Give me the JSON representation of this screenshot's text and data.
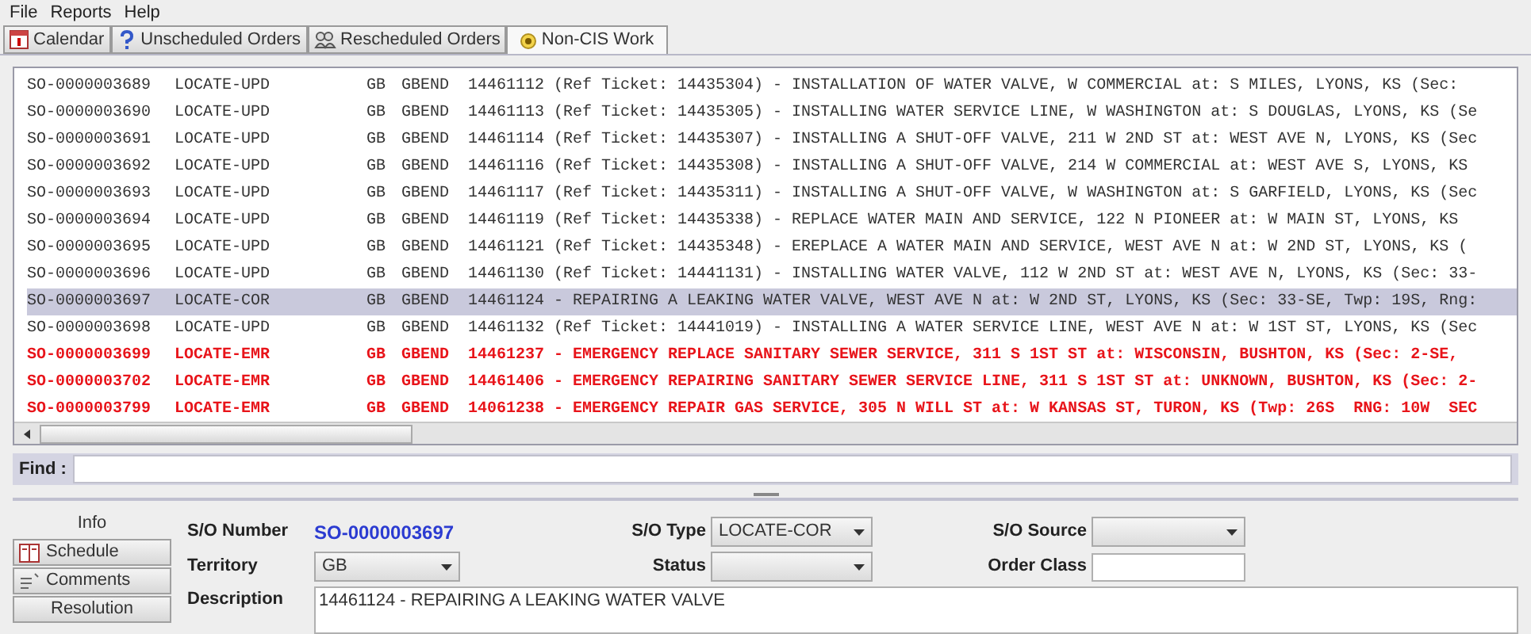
{
  "menu": [
    "File",
    "Reports",
    "Help"
  ],
  "tabs": [
    {
      "label": "Calendar",
      "selected": false
    },
    {
      "label": "Unscheduled Orders",
      "selected": false
    },
    {
      "label": "Rescheduled Orders",
      "selected": false
    },
    {
      "label": "Non-CIS Work",
      "selected": true
    }
  ],
  "rows": [
    {
      "number": "SO-0000003689",
      "type": "LOCATE-UPD",
      "territory": "GB",
      "area": "GBEND",
      "description": "14461112 (Ref Ticket: 14435304) - INSTALLATION OF WATER VALVE, W COMMERCIAL at: S MILES, LYONS, KS (Sec:",
      "emergency": false,
      "selected": false
    },
    {
      "number": "SO-0000003690",
      "type": "LOCATE-UPD",
      "territory": "GB",
      "area": "GBEND",
      "description": "14461113 (Ref Ticket: 14435305) - INSTALLING WATER SERVICE LINE, W WASHINGTON at: S DOUGLAS, LYONS, KS (Se",
      "emergency": false,
      "selected": false
    },
    {
      "number": "SO-0000003691",
      "type": "LOCATE-UPD",
      "territory": "GB",
      "area": "GBEND",
      "description": "14461114 (Ref Ticket: 14435307) - INSTALLING A SHUT-OFF VALVE, 211 W 2ND ST at: WEST AVE N, LYONS, KS (Sec",
      "emergency": false,
      "selected": false
    },
    {
      "number": "SO-0000003692",
      "type": "LOCATE-UPD",
      "territory": "GB",
      "area": "GBEND",
      "description": "14461116 (Ref Ticket: 14435308) - INSTALLING A SHUT-OFF VALVE, 214 W COMMERCIAL at: WEST AVE S, LYONS, KS",
      "emergency": false,
      "selected": false
    },
    {
      "number": "SO-0000003693",
      "type": "LOCATE-UPD",
      "territory": "GB",
      "area": "GBEND",
      "description": "14461117 (Ref Ticket: 14435311) - INSTALLING A SHUT-OFF VALVE, W WASHINGTON at: S GARFIELD, LYONS, KS (Sec",
      "emergency": false,
      "selected": false
    },
    {
      "number": "SO-0000003694",
      "type": "LOCATE-UPD",
      "territory": "GB",
      "area": "GBEND",
      "description": "14461119 (Ref Ticket: 14435338) - REPLACE WATER MAIN AND SERVICE, 122 N PIONEER at: W MAIN ST, LYONS, KS",
      "emergency": false,
      "selected": false
    },
    {
      "number": "SO-0000003695",
      "type": "LOCATE-UPD",
      "territory": "GB",
      "area": "GBEND",
      "description": "14461121 (Ref Ticket: 14435348) - EREPLACE A WATER MAIN AND SERVICE, WEST AVE N at: W 2ND ST, LYONS, KS (",
      "emergency": false,
      "selected": false
    },
    {
      "number": "SO-0000003696",
      "type": "LOCATE-UPD",
      "territory": "GB",
      "area": "GBEND",
      "description": "14461130 (Ref Ticket: 14441131) - INSTALLING WATER VALVE, 112 W 2ND ST at: WEST AVE N, LYONS, KS (Sec: 33-",
      "emergency": false,
      "selected": false
    },
    {
      "number": "SO-0000003697",
      "type": "LOCATE-COR",
      "territory": "GB",
      "area": "GBEND",
      "description": "14461124 - REPAIRING A LEAKING WATER VALVE, WEST AVE N at: W 2ND ST, LYONS, KS (Sec: 33-SE, Twp: 19S, Rng:",
      "emergency": false,
      "selected": true
    },
    {
      "number": "SO-0000003698",
      "type": "LOCATE-UPD",
      "territory": "GB",
      "area": "GBEND",
      "description": "14461132 (Ref Ticket: 14441019) - INSTALLING A WATER SERVICE LINE, WEST AVE N at: W 1ST ST, LYONS, KS (Sec",
      "emergency": false,
      "selected": false
    },
    {
      "number": "SO-0000003699",
      "type": "LOCATE-EMR",
      "territory": "GB",
      "area": "GBEND",
      "description": "14461237 - EMERGENCY REPLACE SANITARY SEWER SERVICE, 311 S 1ST ST at: WISCONSIN, BUSHTON, KS (Sec: 2-SE,",
      "emergency": true,
      "selected": false
    },
    {
      "number": "SO-0000003702",
      "type": "LOCATE-EMR",
      "territory": "GB",
      "area": "GBEND",
      "description": "14461406 - EMERGENCY REPAIRING SANITARY SEWER SERVICE LINE, 311 S 1ST ST at: UNKNOWN, BUSHTON, KS (Sec: 2-",
      "emergency": true,
      "selected": false
    },
    {
      "number": "SO-0000003799",
      "type": "LOCATE-EMR",
      "territory": "GB",
      "area": "GBEND",
      "description": "14061238 - EMERGENCY REPAIR GAS SERVICE, 305 N WILL ST at: W KANSAS ST, TURON, KS (Twp: 26S  RNG: 10W  SEC",
      "emergency": true,
      "selected": false
    }
  ],
  "find": {
    "label": "Find :"
  },
  "nav": [
    {
      "label": "Info",
      "selected": true
    },
    {
      "label": "Schedule",
      "selected": false
    },
    {
      "label": "Comments",
      "selected": false
    },
    {
      "label": "Resolution",
      "selected": false
    }
  ],
  "form": {
    "so_number": {
      "label": "S/O Number",
      "value": "SO-0000003697"
    },
    "so_type": {
      "label": "S/O Type",
      "value": "LOCATE-COR"
    },
    "so_source": {
      "label": "S/O Source"
    },
    "territory": {
      "label": "Territory",
      "value": "GB"
    },
    "status": {
      "label": "Status"
    },
    "order_class": {
      "label": "Order Class"
    },
    "description": {
      "label": "Description",
      "value": "14461124 - REPAIRING A LEAKING WATER VALVE"
    }
  }
}
